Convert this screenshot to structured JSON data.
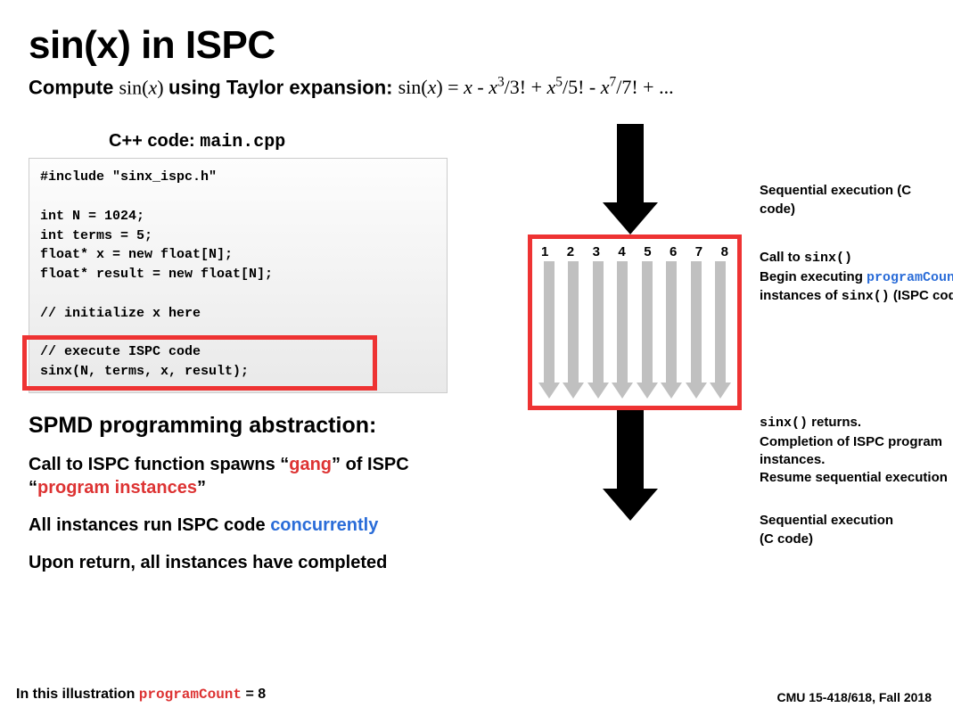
{
  "title": "sin(x) in ISPC",
  "subtitle_lead": "Compute",
  "subtitle_mid": "using Taylor expansion:",
  "cpp_header_lead": "C++ code:",
  "cpp_header_file": "main.cpp",
  "code": "#include \"sinx_ispc.h\"\n\nint N = 1024;\nint terms = 5;\nfloat* x = new float[N];\nfloat* result = new float[N];\n\n// initialize x here\n\n// execute ISPC code\nsinx(N, terms, x, result);",
  "abstraction_title": "SPMD programming abstraction:",
  "bullet1_a": "Call to ISPC function spawns “",
  "bullet1_gang": "gang",
  "bullet1_b": "” of ISPC",
  "bullet1_c": "“",
  "bullet1_pi": "program instances",
  "bullet1_d": "”",
  "bullet2_a": "All instances run ISPC code ",
  "bullet2_conc": "concurrently",
  "bullet3": "Upon return, all instances have completed",
  "chart_data": {
    "type": "diagram",
    "lanes": [
      1,
      2,
      3,
      4,
      5,
      6,
      7,
      8
    ],
    "program_count": 8
  },
  "diagram": {
    "labels": {
      "seq_top": "Sequential execution (C code)",
      "call_a": "Call to ",
      "call_sinx": "sinx()",
      "begin_a": "Begin executing ",
      "begin_pc": "programCount",
      "begin_b": "instances of ",
      "begin_sinx": "sinx()",
      "begin_c": "  (ISPC code)",
      "ret_sinx": "sinx()",
      "ret_a": " returns.",
      "ret_b": "Completion of ISPC program instances.",
      "ret_c": "Resume sequential execution",
      "seq_bot_a": "Sequential execution",
      "seq_bot_b": "(C code)"
    }
  },
  "footnote_left_a": "In this illustration ",
  "footnote_left_pc": "programCount",
  "footnote_left_b": " = 8",
  "footnote_right": "CMU 15-418/618, Fall 2018"
}
